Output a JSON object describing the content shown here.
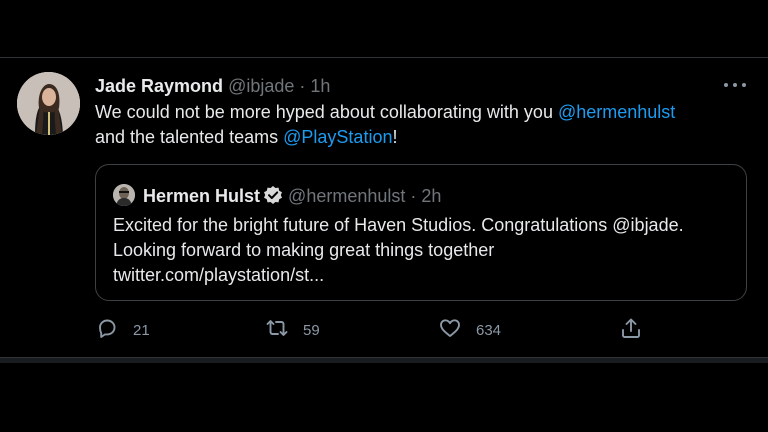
{
  "tweet": {
    "author_name": "Jade Raymond",
    "author_handle": "@ibjade",
    "separator": " · ",
    "time": "1h",
    "text_part1": "We could not be more hyped about collaborating with you ",
    "mention1": "@hermenhulst",
    "text_part2": " and the talented teams ",
    "mention2": "@PlayStation",
    "text_part3": "!"
  },
  "quoted_tweet": {
    "author_name": "Hermen Hulst",
    "author_handle": "@hermenhulst",
    "separator": " · ",
    "time": "2h",
    "text_line1": "Excited for the bright future of Haven Studios. Congratulations @ibjade.",
    "text_line2": "Looking forward to making great things together",
    "text_line3": "twitter.com/playstation/st..."
  },
  "actions": {
    "reply_count": "21",
    "retweet_count": "59",
    "like_count": "634"
  },
  "colors": {
    "background": "#000000",
    "text": "#e7e9ea",
    "muted": "#71767b",
    "accent": "#1d9bf0",
    "border": "#3e4144"
  },
  "icons": [
    "more-icon",
    "verified-badge-icon",
    "reply-icon",
    "retweet-icon",
    "like-icon",
    "share-icon"
  ]
}
